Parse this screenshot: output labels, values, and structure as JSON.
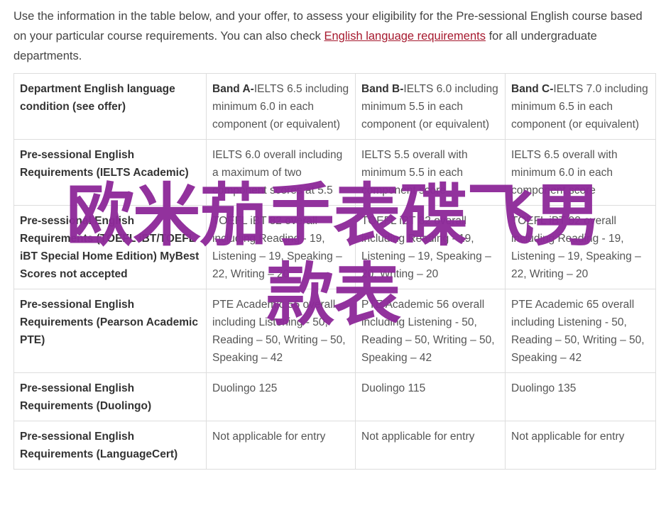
{
  "intro": {
    "text_before": "Use the information in the table below, and your offer, to assess your eligibility for the Pre-sessional English course based on your particular course requirements. You can also check ",
    "link_text": "English language requirements",
    "text_after": " for all undergraduate departments."
  },
  "table": {
    "header": {
      "label": "Department English language condition (see offer)",
      "bands": [
        {
          "name": "Band A-",
          "desc": "IELTS 6.5 including minimum 6.0 in each component (or equivalent)"
        },
        {
          "name": "Band B-",
          "desc": "IELTS 6.0 including minimum 5.5 in each component (or equivalent)"
        },
        {
          "name": "Band C-",
          "desc": "IELTS 7.0 including minimum 6.5 in each component (or equivalent)"
        }
      ]
    },
    "rows": [
      {
        "label": "Pre-sessional English Requirements (IELTS Academic)",
        "cells": [
          "IELTS 6.0 overall including a maximum of two component scores at 5.5",
          "IELTS 5.5 overall with minimum 5.5 in each component score",
          "IELTS 6.5 overall with minimum 6.0 in each component score"
        ]
      },
      {
        "label": "Pre-sessional English Requirements (TOEFL iBT/TOEFL iBT Special Home Edition) MyBest Scores not accepted",
        "cells": [
          "TOEFL iBT 82 overall including Reading - 19, Listening – 19, Speaking – 22, Writing – 20",
          "TOEFL iBT 82 overall including Reading - 19, Listening – 19, Speaking – 20, Writing – 20",
          "TOEFL iBT 92 overall including Reading - 19, Listening – 19, Speaking – 22, Writing – 20"
        ]
      },
      {
        "label": "Pre-sessional English Requirements (Pearson Academic PTE)",
        "cells": [
          "PTE Academic 56 overall including Listening - 50, Reading – 50, Writing – 50, Speaking – 42",
          "PTE Academic 56 overall including Listening - 50, Reading – 50, Writing – 50, Speaking – 42",
          "PTE Academic 65 overall including Listening - 50, Reading – 50, Writing – 50, Speaking – 42"
        ]
      },
      {
        "label": "Pre-sessional English Requirements (Duolingo)",
        "cells": [
          "Duolingo 125",
          "Duolingo 115",
          "Duolingo 135"
        ]
      },
      {
        "label": "Pre-sessional English Requirements (LanguageCert)",
        "cells": [
          "Not applicable for entry",
          "Not applicable for entry",
          "Not applicable for entry"
        ]
      }
    ]
  },
  "overlay": {
    "line1": "欧米茄手表碟飞男",
    "line2": "款表"
  },
  "colors": {
    "link": "#a6192e",
    "overlay": "#8e2a9a",
    "border": "#dddddd"
  }
}
